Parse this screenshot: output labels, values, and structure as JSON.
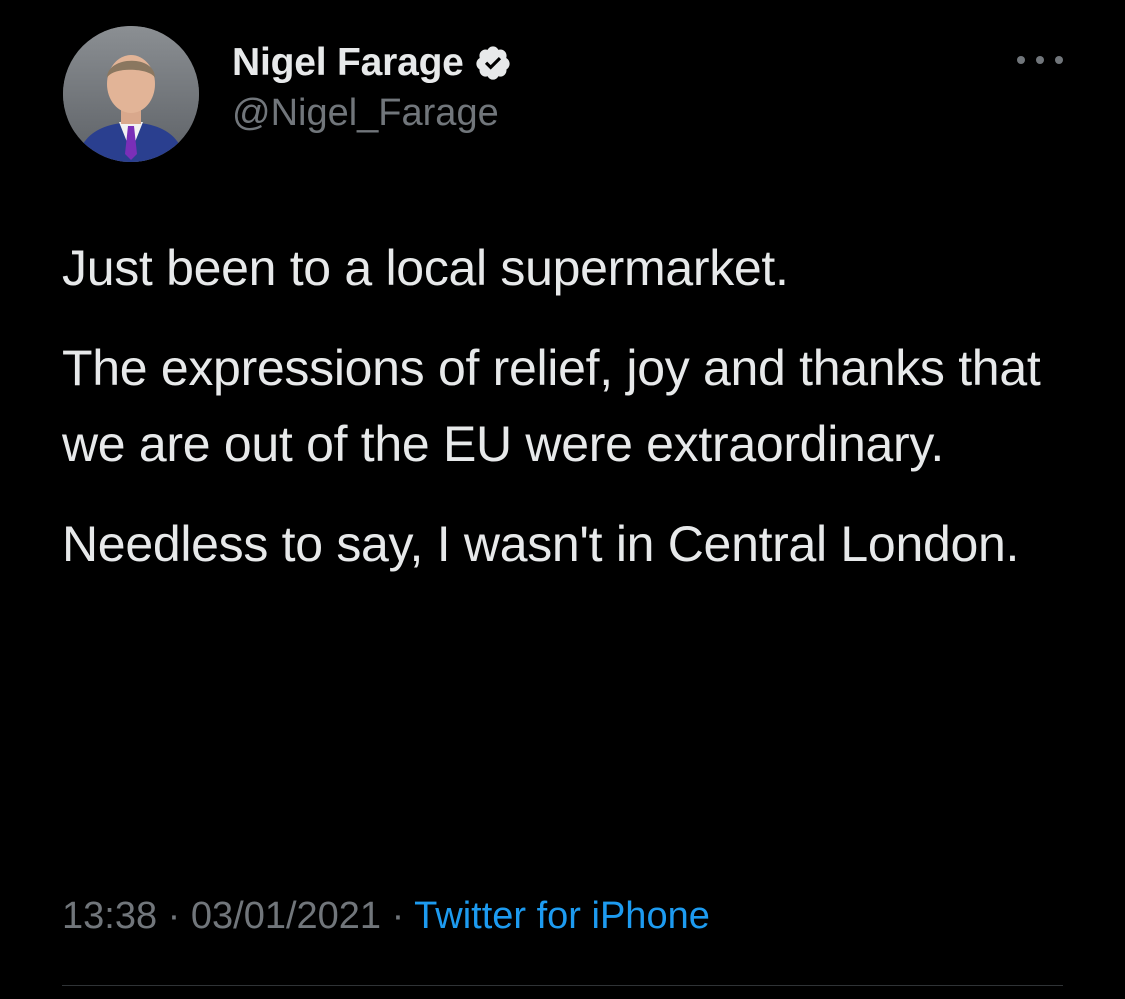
{
  "author": {
    "display_name": "Nigel Farage",
    "handle": "@Nigel_Farage",
    "verified_icon": "verified-badge-icon"
  },
  "tweet": {
    "paragraphs": [
      "Just been to a local supermarket.",
      "The expressions of relief, joy and thanks that we are out of the EU were extraordinary.",
      "Needless to say, I wasn't in Central London."
    ],
    "time": "13:38",
    "separator": "·",
    "date": "03/01/2021",
    "source": "Twitter for iPhone"
  },
  "colors": {
    "background": "#000000",
    "primary_text": "#e7e9ea",
    "secondary_text": "#71767b",
    "link": "#1d9bf0",
    "divider": "#2f3336"
  },
  "icons": {
    "more": "more-options-icon",
    "avatar": "profile-avatar"
  }
}
